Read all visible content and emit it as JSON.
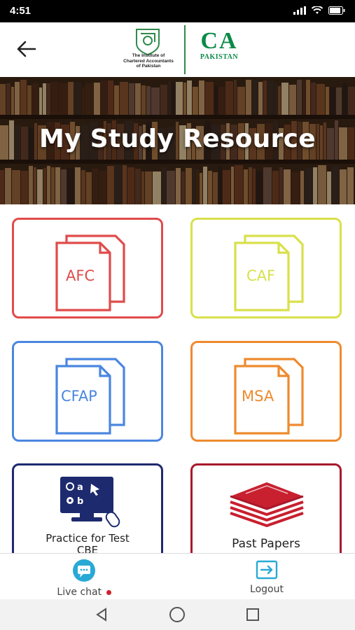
{
  "status": {
    "time": "4:51"
  },
  "header": {
    "logo_text_1": "The Institute of",
    "logo_text_2": "Chartered Accountants",
    "logo_text_3": "of Pakistan",
    "brand_mark": "CA",
    "brand_sub": "PAKISTAN"
  },
  "banner": {
    "title": "My Study Resource"
  },
  "cards": [
    {
      "label": "AFC",
      "color": "#e04b4b"
    },
    {
      "label": "CAF",
      "color": "#d9e04a"
    },
    {
      "label": "CFAP",
      "color": "#4a86e0"
    },
    {
      "label": "MSA",
      "color": "#ee8a2e"
    },
    {
      "label": "Practice for Test\nCBE",
      "color": "#1d2a6e"
    },
    {
      "label": "Past Papers",
      "color": "#a8192b"
    }
  ],
  "bottom": {
    "chat_label": "Live chat",
    "logout_label": "Logout"
  }
}
